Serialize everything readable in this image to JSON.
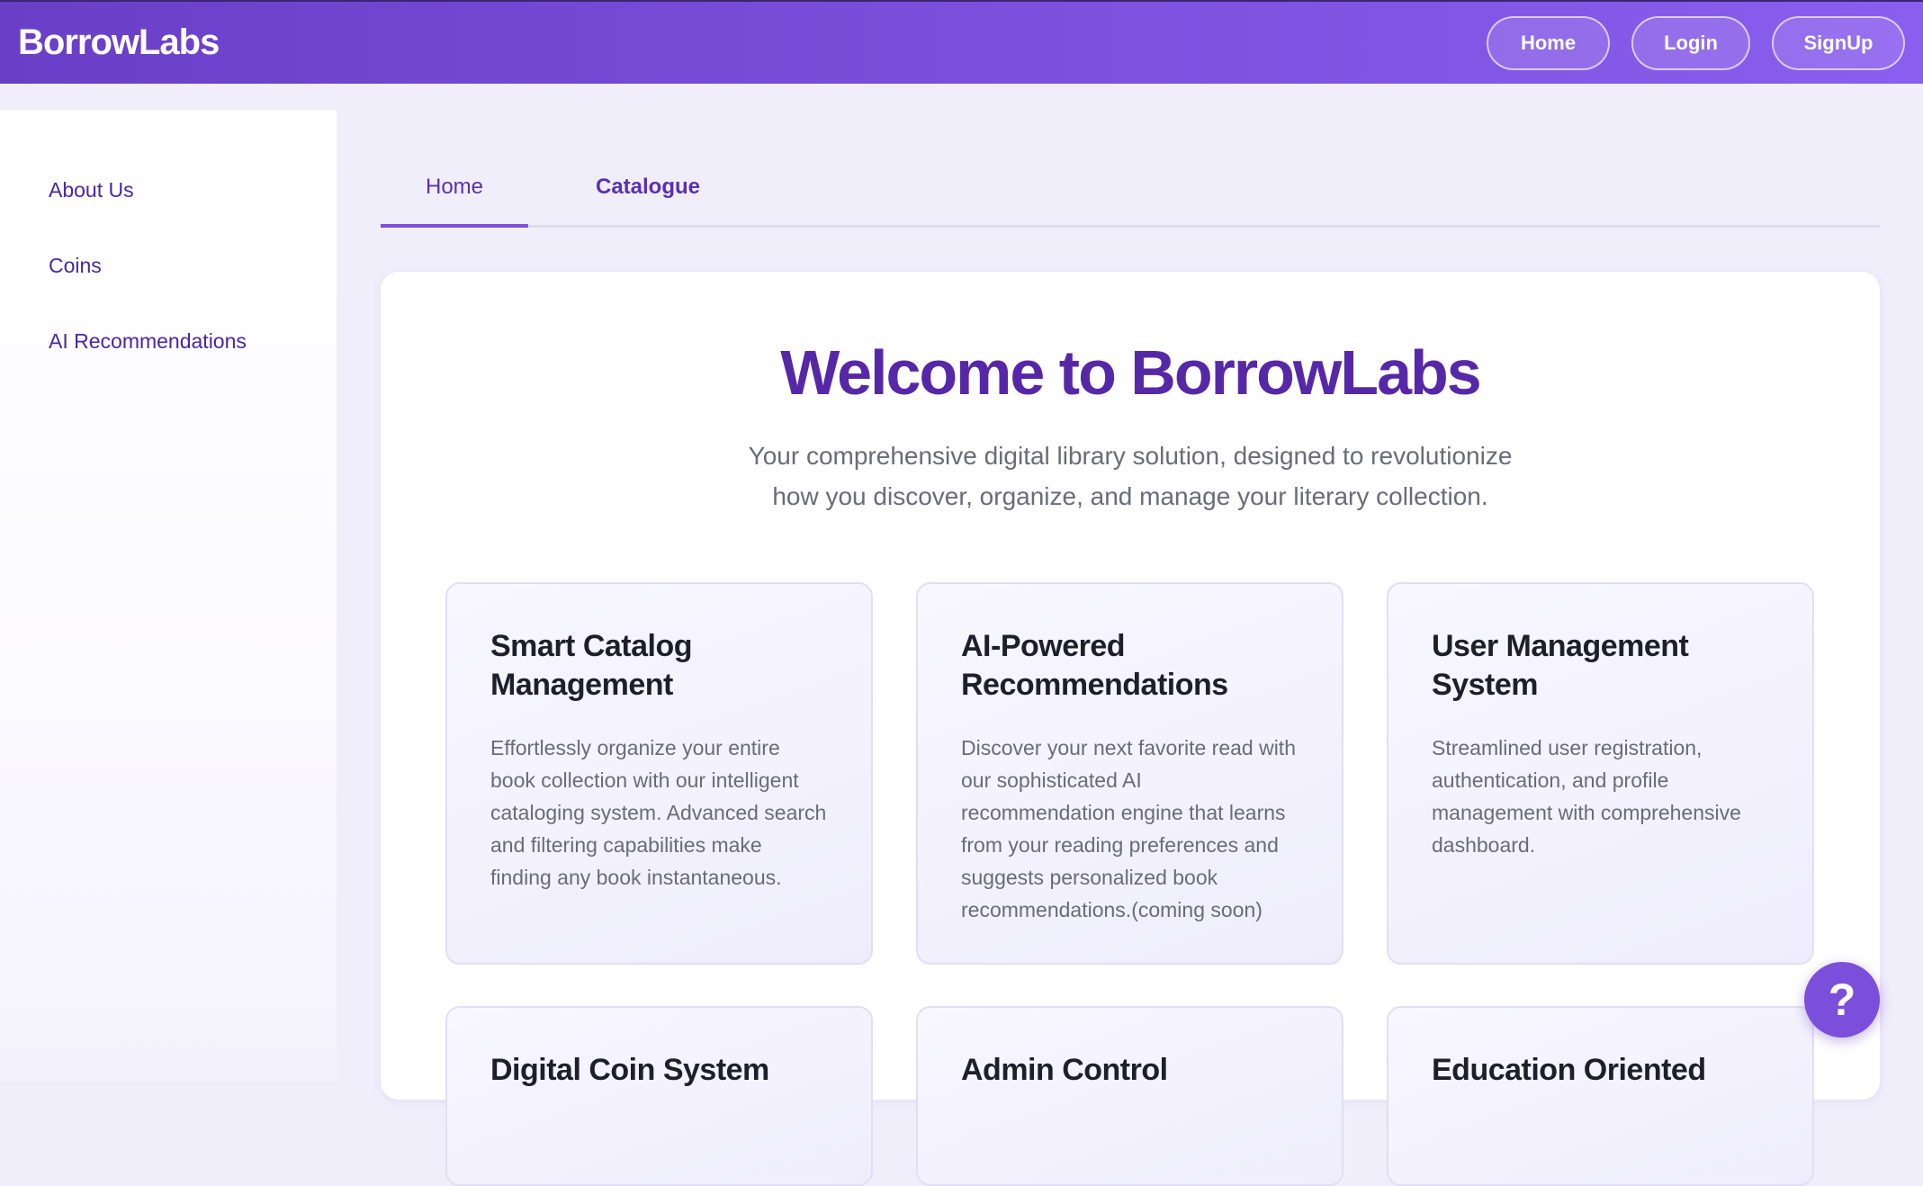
{
  "header": {
    "logo": "BorrowLabs",
    "nav": {
      "home": "Home",
      "login": "Login",
      "signup": "SignUp"
    }
  },
  "sidebar": {
    "items": [
      {
        "label": "About Us"
      },
      {
        "label": "Coins"
      },
      {
        "label": "AI Recommendations"
      }
    ]
  },
  "tabs": [
    {
      "label": "Home",
      "active": true
    },
    {
      "label": "Catalogue",
      "active": false
    }
  ],
  "main": {
    "title": "Welcome to BorrowLabs",
    "subtitle_line1": "Your comprehensive digital library solution, designed to revolutionize",
    "subtitle_line2": "how you discover, organize, and manage your literary collection.",
    "features": [
      {
        "title": "Smart Catalog Management",
        "description": "Effortlessly organize your entire book collection with our intelligent cataloging system. Advanced search and filtering capabilities make finding any book instantaneous."
      },
      {
        "title": "AI-Powered Recommendations",
        "description": "Discover your next favorite read with our sophisticated AI recommendation engine that learns from your reading preferences and suggests personalized book recommendations.(coming soon)"
      },
      {
        "title": "User Management System",
        "description": "Streamlined user registration, authentication, and profile management with comprehensive dashboard."
      },
      {
        "title": "Digital Coin System"
      },
      {
        "title": "Admin Control"
      },
      {
        "title": "Education Oriented"
      }
    ]
  },
  "help": {
    "label": "?"
  },
  "colors": {
    "brand": "#7b4fdb",
    "heading": "#5628a8",
    "sidebar_link": "#4a28a0"
  }
}
